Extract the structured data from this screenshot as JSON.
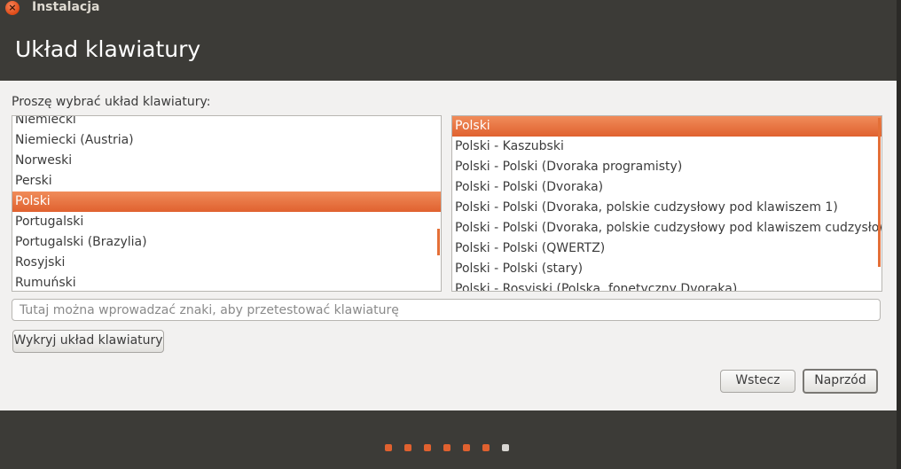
{
  "window": {
    "title": "Instalacja",
    "close_icon": "close-icon",
    "close_glyph": "×"
  },
  "header": {
    "title": "Układ klawiatury"
  },
  "main": {
    "prompt": "Proszę wybrać układ klawiatury:",
    "layouts": [
      {
        "label": "Niemiecki",
        "selected": false
      },
      {
        "label": "Niemiecki (Austria)",
        "selected": false
      },
      {
        "label": "Norweski",
        "selected": false
      },
      {
        "label": "Perski",
        "selected": false
      },
      {
        "label": "Polski",
        "selected": true
      },
      {
        "label": "Portugalski",
        "selected": false
      },
      {
        "label": "Portugalski (Brazylia)",
        "selected": false
      },
      {
        "label": "Rosyjski",
        "selected": false
      },
      {
        "label": "Rumuński",
        "selected": false
      }
    ],
    "variants": [
      {
        "label": "Polski",
        "selected": true
      },
      {
        "label": "Polski - Kaszubski",
        "selected": false
      },
      {
        "label": "Polski - Polski (Dvoraka programisty)",
        "selected": false
      },
      {
        "label": "Polski - Polski (Dvoraka)",
        "selected": false
      },
      {
        "label": "Polski - Polski (Dvoraka, polskie cudzysłowy pod klawiszem 1)",
        "selected": false
      },
      {
        "label": "Polski - Polski (Dvoraka, polskie cudzysłowy pod klawiszem cudzysłowu)",
        "selected": false
      },
      {
        "label": "Polski - Polski (QWERTZ)",
        "selected": false
      },
      {
        "label": "Polski - Polski (stary)",
        "selected": false
      },
      {
        "label": "Polski - Rosyjski (Polska, fonetyczny Dvoraka)",
        "selected": false
      }
    ],
    "test_input": {
      "value": "",
      "placeholder": "Tutaj można wprowadzać znaki, aby przetestować klawiaturę"
    },
    "detect_button": "Wykryj układ klawiatury"
  },
  "nav": {
    "back_label": "Wstecz",
    "forward_label": "Naprzód"
  },
  "progress": {
    "steps_total": 7,
    "current_step": 7
  },
  "colors": {
    "accent": "#e05a24",
    "selection_top": "#f08c5a",
    "selection_bottom": "#e0612f",
    "dark_chrome": "#3c3b37",
    "dialog_bg": "#f2f1f0",
    "step_done": "#e0612f",
    "step_current": "#d8d6d2"
  }
}
